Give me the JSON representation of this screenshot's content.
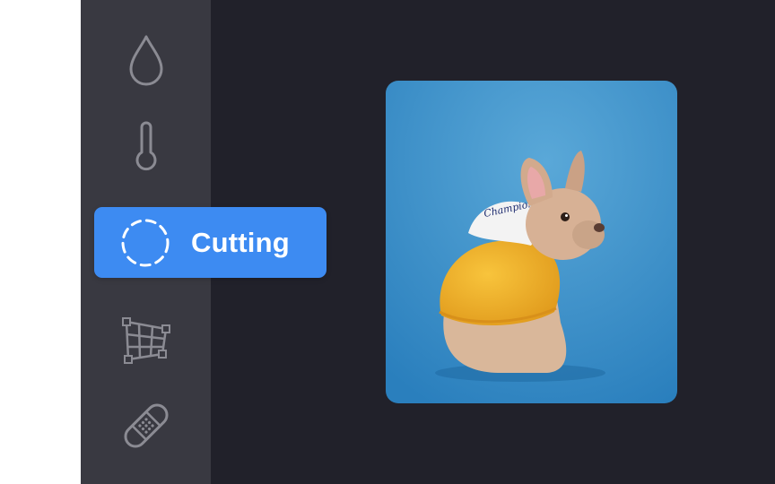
{
  "tools": [
    {
      "id": "color",
      "icon": "drop-icon",
      "active": false
    },
    {
      "id": "temperature",
      "icon": "thermometer-icon",
      "active": false
    },
    {
      "id": "cutting",
      "icon": "dashed-circle-icon",
      "label": "Cutting",
      "active": true
    },
    {
      "id": "warp",
      "icon": "warp-grid-icon",
      "active": false
    },
    {
      "id": "heal",
      "icon": "bandage-icon",
      "active": false
    }
  ],
  "photo": {
    "subject": "french-bulldog-in-yellow-hoodie",
    "hoodie_lettering": "Champion"
  },
  "colors": {
    "sidebar": "#393941",
    "canvas": "#21212a",
    "accent": "#3d8bf2",
    "photo_background": "#3c8fc8",
    "hoodie": "#f0ad2a"
  }
}
